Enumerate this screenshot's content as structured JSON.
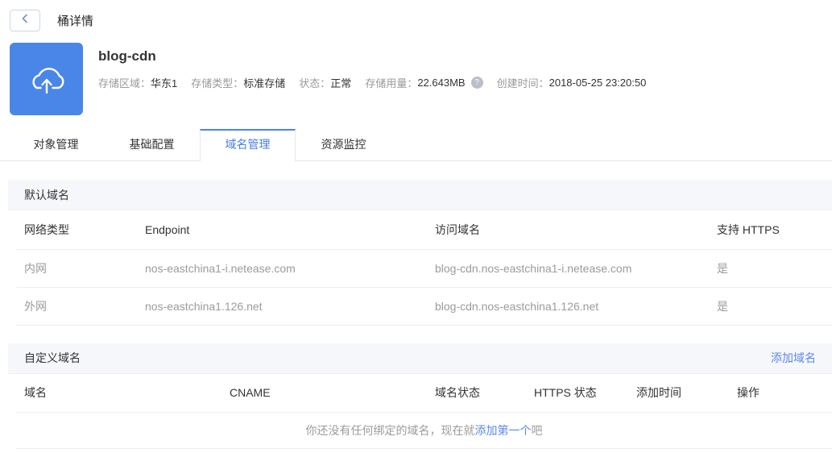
{
  "colors": {
    "accent": "#4a86e8",
    "link": "#5c87e8",
    "icon_background": "#4a86e8"
  },
  "page": {
    "back_label": "桶详情"
  },
  "bucket": {
    "name": "blog-cdn",
    "info": {
      "region_label": "存储区域：",
      "region_value": "华东1",
      "type_label": "存储类型：",
      "type_value": "标准存储",
      "status_label": "状态：",
      "status_value": "正常",
      "usage_label": "存储用量：",
      "usage_value": "22.643MB",
      "help_glyph": "?",
      "created_label": "创建时间：",
      "created_value": "2018-05-25 23:20:50"
    }
  },
  "tabs": [
    {
      "label": "对象管理",
      "active": false
    },
    {
      "label": "基础配置",
      "active": false
    },
    {
      "label": "域名管理",
      "active": true
    },
    {
      "label": "资源监控",
      "active": false
    }
  ],
  "default_domain": {
    "title": "默认域名",
    "columns": [
      "网络类型",
      "Endpoint",
      "访问域名",
      "支持 HTTPS"
    ],
    "rows": [
      [
        "内网",
        "nos-eastchina1-i.netease.com",
        "blog-cdn.nos-eastchina1-i.netease.com",
        "是"
      ],
      [
        "外网",
        "nos-eastchina1.126.net",
        "blog-cdn.nos-eastchina1.126.net",
        "是"
      ]
    ]
  },
  "custom_domain": {
    "title": "自定义域名",
    "add_link_label": "添加域名",
    "columns": [
      "域名",
      "CNAME",
      "域名状态",
      "HTTPS 状态",
      "添加时间",
      "操作"
    ],
    "empty": {
      "prefix": "你还没有任何绑定的域名，现在就",
      "link": "添加第一个",
      "suffix": "吧"
    }
  }
}
